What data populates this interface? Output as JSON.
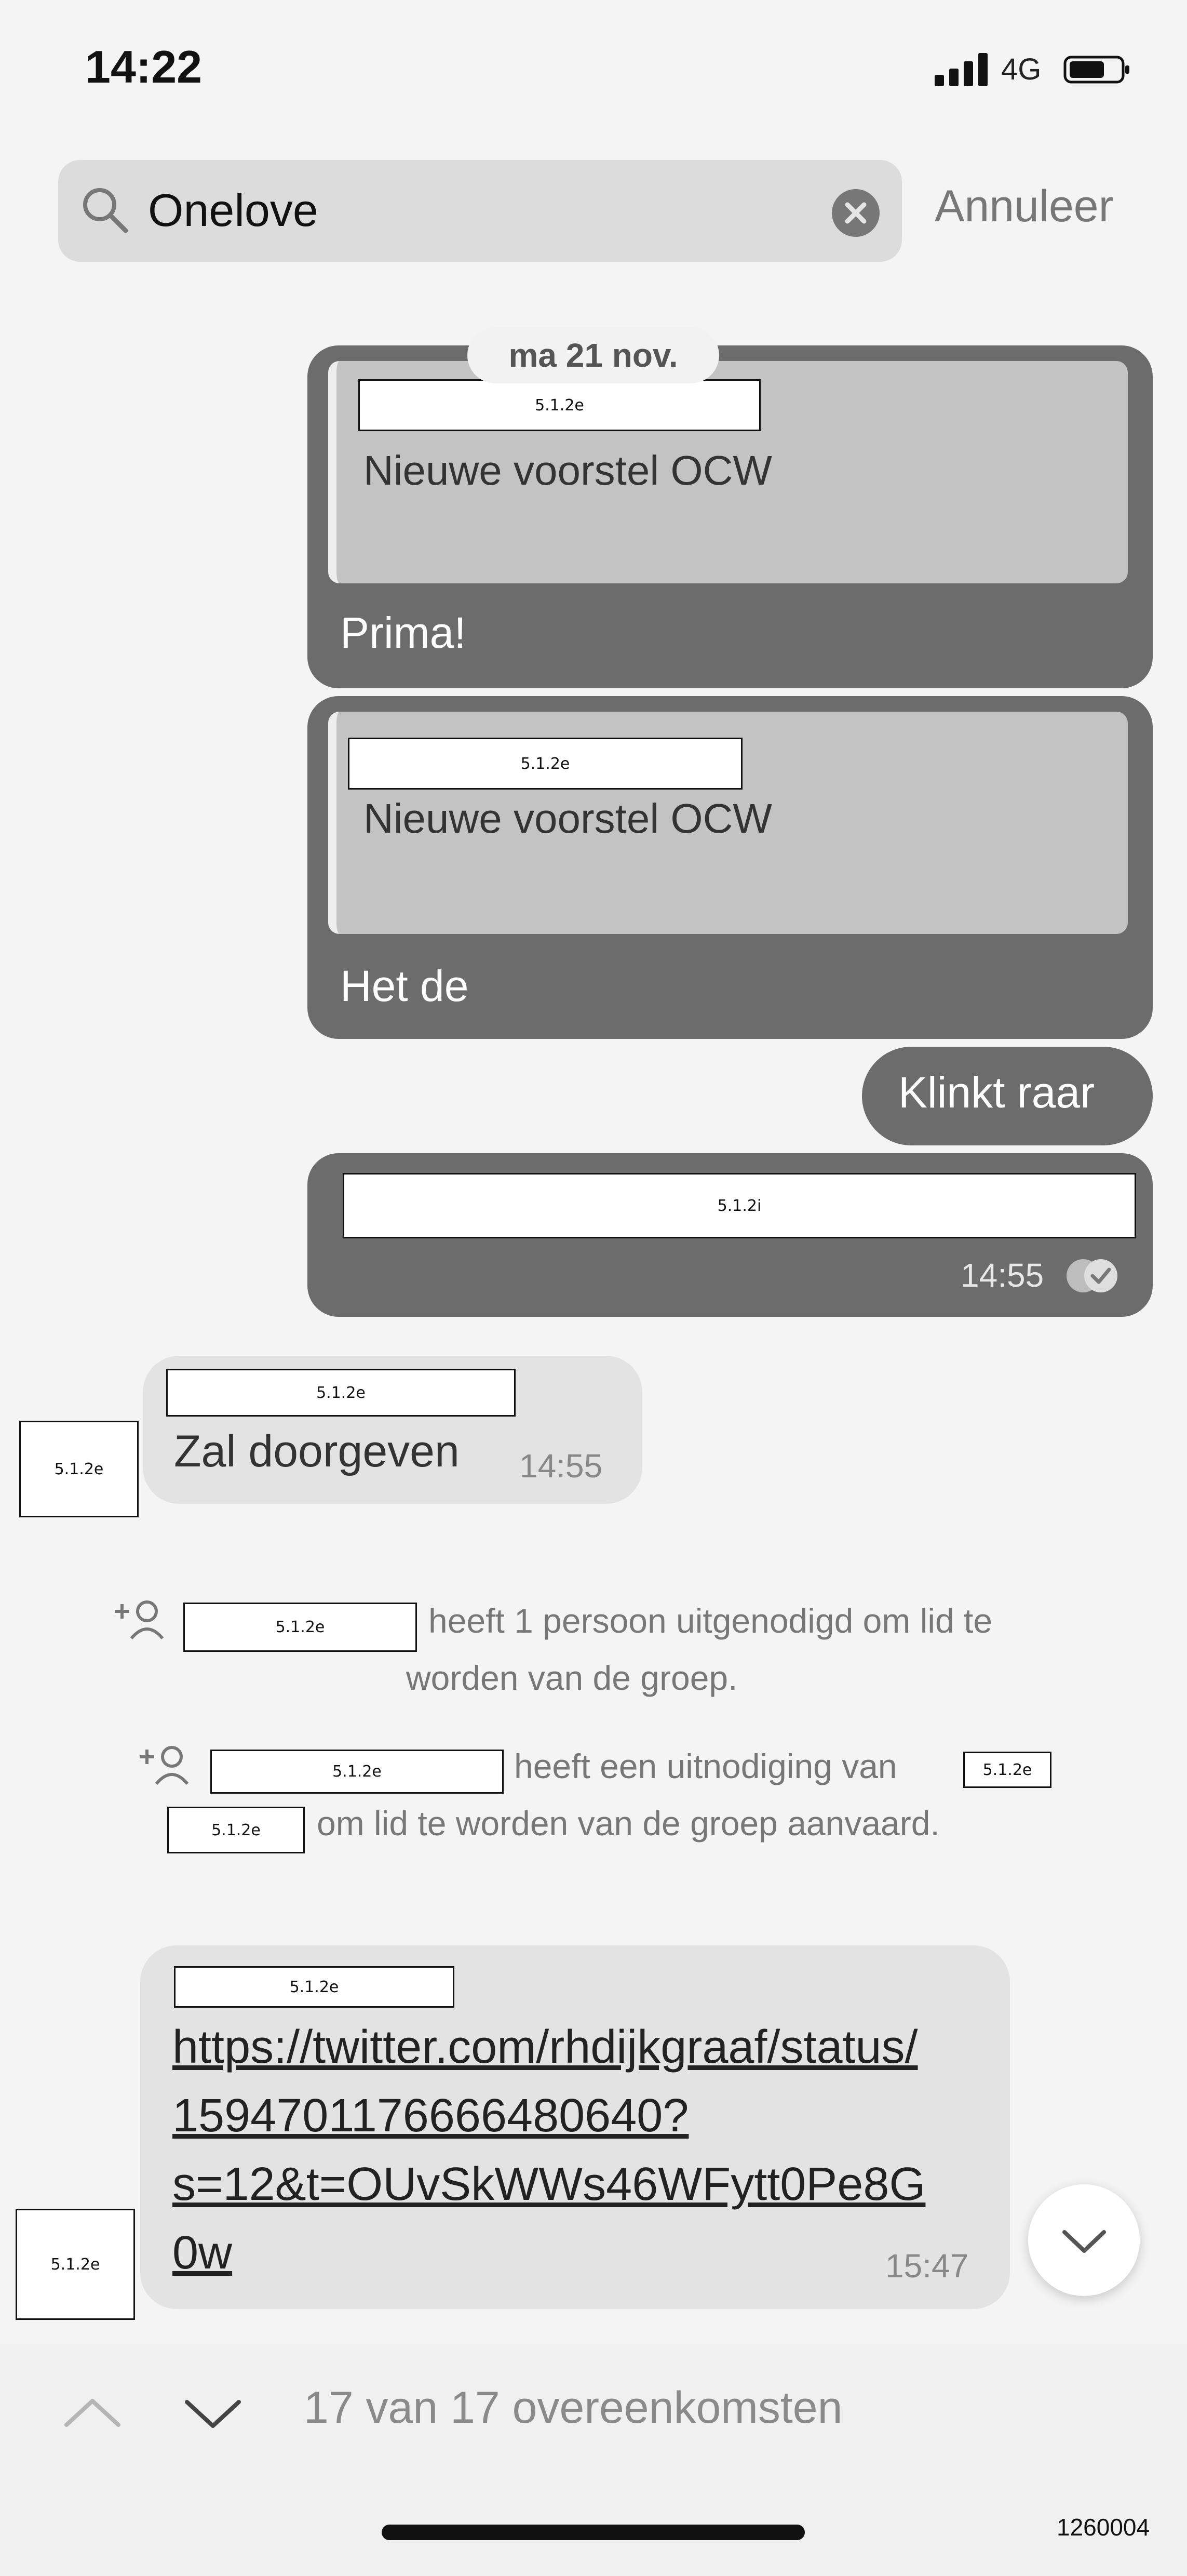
{
  "status_bar": {
    "time": "14:22",
    "network": "4G",
    "icons": [
      "signal-icon",
      "battery-icon"
    ]
  },
  "search": {
    "query": "Onelove",
    "cancel_label": "Annuleer"
  },
  "date_separator": "ma 21 nov.",
  "messages": [
    {
      "redaction": "5.1.2e",
      "quote": "Nieuwe voorstel OCW",
      "text": "Prima!"
    },
    {
      "redaction": "5.1.2e",
      "quote": "Nieuwe voorstel OCW",
      "text": "Het de"
    },
    {
      "text": "Klinkt raar"
    },
    {
      "redaction": "5.1.2i",
      "time": "14:55"
    }
  ],
  "incoming": {
    "sender_redaction": "5.1.2e",
    "avatar_redaction": "5.1.2e",
    "text": "Zal doorgeven",
    "time": "14:55"
  },
  "system_messages": [
    {
      "redaction": "5.1.2e",
      "text_line1": "heeft 1 persoon uitgenodigd om lid te",
      "text_line2": "worden van de groep."
    },
    {
      "redaction": "5.1.2e",
      "text_line1": "heeft een uitnodiging van",
      "redaction2": "5.1.2e",
      "redaction3": "5.1.2e",
      "text_line2": "om lid te worden van de groep aanvaard."
    }
  ],
  "link_message": {
    "sender_redaction": "5.1.2e",
    "avatar_redaction": "5.1.2e",
    "lines": [
      "https://twitter.com/rhdijkgraaf/status/",
      "1594701176666480640?",
      "s=12&t=OUvSkWWs46WFytt0Pe8G",
      "0w"
    ],
    "time": "15:47"
  },
  "footer": {
    "match_count": "17 van 17 overeenkomsten",
    "doc_number": "1260004"
  },
  "colors": {
    "bubble_outgoing": "#6c6c6c",
    "bubble_incoming": "#e3e3e3",
    "quote": "#c3c3c3"
  }
}
